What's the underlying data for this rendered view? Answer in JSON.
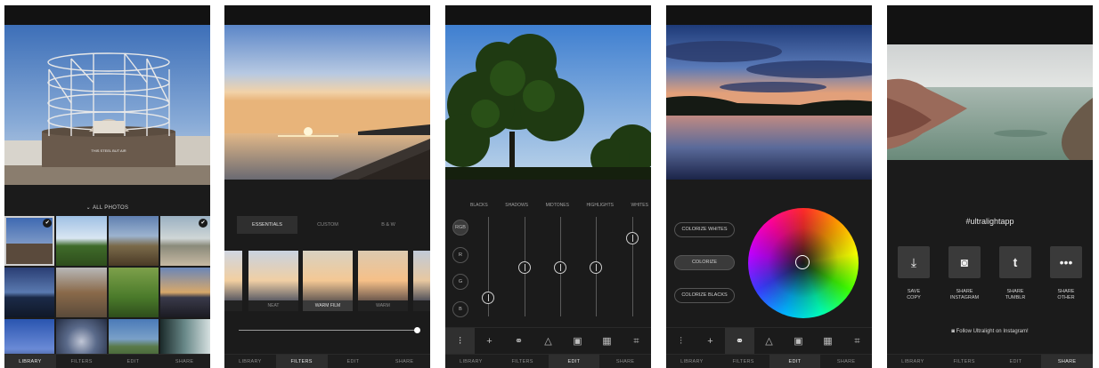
{
  "library": {
    "dropdown_label": "ALL PHOTOS",
    "dropdown_icon": "chevron-down-icon",
    "check_icon": "check-icon",
    "selected_cells": [
      0,
      3
    ],
    "sign_text": "THIS STEEL BUT AIR"
  },
  "filters": {
    "tabs": [
      "ESSENTIALS",
      "CUSTOM",
      "B & W"
    ],
    "active_tab": 0,
    "thumbnails": [
      "",
      "NEAT",
      "WARM FILM",
      "WARM",
      ""
    ],
    "selected_thumbnail": 2,
    "intensity": 1.0
  },
  "curves": {
    "channel_labels": [
      "BLACKS",
      "SHADOWS",
      "MIDTONES",
      "HIGHLIGHTS",
      "WHITES"
    ],
    "channel_buttons": [
      "RGB",
      "R",
      "G",
      "B"
    ],
    "active_channel": 0
  },
  "colorize": {
    "options": [
      "COLORIZE WHITES",
      "COLORIZE",
      "COLORIZE BLACKS"
    ],
    "active_option": 1
  },
  "edit_tools": [
    "sliders-icon",
    "plus-icon",
    "circles-icon",
    "triangle-icon",
    "vignette-icon",
    "checker-icon",
    "crop-icon"
  ],
  "share": {
    "hashtag": "#ultralightapp",
    "buttons": [
      {
        "icon": "download-icon",
        "line1": "SAVE",
        "line2": "COPY"
      },
      {
        "icon": "instagram-icon",
        "line1": "SHARE",
        "line2": "INSTAGRAM"
      },
      {
        "icon": "tumblr-icon",
        "line1": "SHARE",
        "line2": "TUMBLR"
      },
      {
        "icon": "more-icon",
        "line1": "SHARE",
        "line2": "OTHER"
      }
    ],
    "follow_text": "Follow Ultralight on Instagram!"
  },
  "nav_tabs": [
    "LIBRARY",
    "FILTERS",
    "EDIT",
    "SHARE"
  ],
  "screens_active_tab": [
    0,
    1,
    2,
    2,
    3
  ]
}
